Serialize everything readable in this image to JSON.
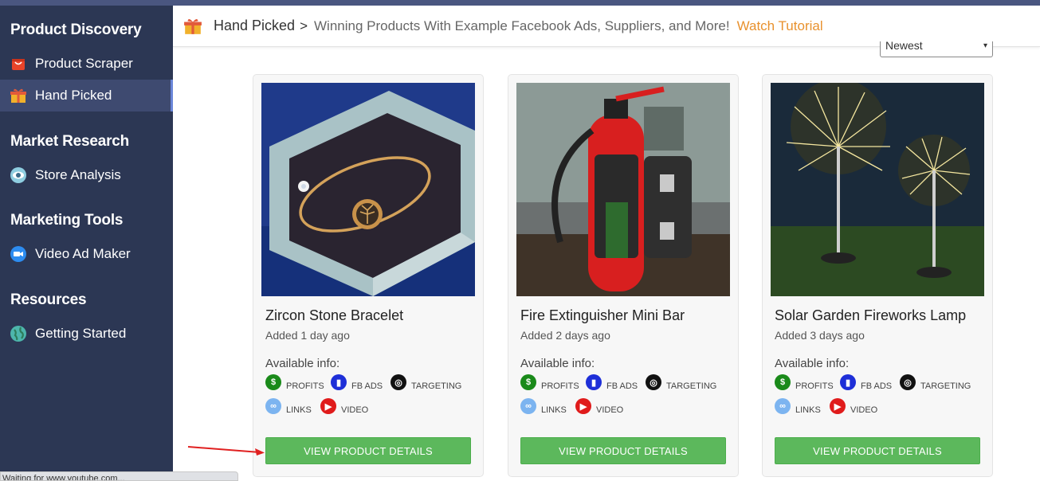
{
  "sidebar": {
    "sections": [
      {
        "title": "Product Discovery",
        "items": [
          {
            "label": "Product Scraper",
            "icon": "aliexpress-bag-icon"
          },
          {
            "label": "Hand Picked",
            "icon": "gift-icon",
            "active": true
          }
        ]
      },
      {
        "title": "Market Research",
        "items": [
          {
            "label": "Store Analysis",
            "icon": "eye-icon"
          }
        ]
      },
      {
        "title": "Marketing Tools",
        "items": [
          {
            "label": "Video Ad Maker",
            "icon": "video-camera-icon"
          }
        ]
      },
      {
        "title": "Resources",
        "items": [
          {
            "label": "Getting Started",
            "icon": "globe-icon"
          }
        ]
      }
    ]
  },
  "header": {
    "breadcrumb": "Hand Picked",
    "separator": ">",
    "subtitle": "Winning Products With Example Facebook Ads, Suppliers, and More!",
    "tutorial_link": "Watch Tutorial"
  },
  "sort": {
    "selected": "Newest"
  },
  "info_tags": {
    "profits": "PROFITS",
    "fb_ads": "FB ADS",
    "targeting": "TARGETING",
    "links": "LINKS",
    "video": "VIDEO"
  },
  "products": [
    {
      "name": "Zircon Stone Bracelet",
      "added": "Added 1 day ago",
      "available_label": "Available info:",
      "button": "VIEW PRODUCT DETAILS"
    },
    {
      "name": "Fire Extinguisher Mini Bar",
      "added": "Added 2 days ago",
      "available_label": "Available info:",
      "button": "VIEW PRODUCT DETAILS"
    },
    {
      "name": "Solar Garden Fireworks Lamp",
      "added": "Added 3 days ago",
      "available_label": "Available info:",
      "button": "VIEW PRODUCT DETAILS"
    }
  ],
  "status_bar": "Waiting for www.youtube.com...",
  "colors": {
    "sidebar_bg": "#2c3754",
    "accent_orange": "#e8912d",
    "button_green": "#5cb85c",
    "profits_green": "#1a8a1a",
    "fbads_blue": "#1e2fd8",
    "targeting_black": "#111111",
    "links_lightblue": "#7cb4f0",
    "video_red": "#e01b1b"
  }
}
